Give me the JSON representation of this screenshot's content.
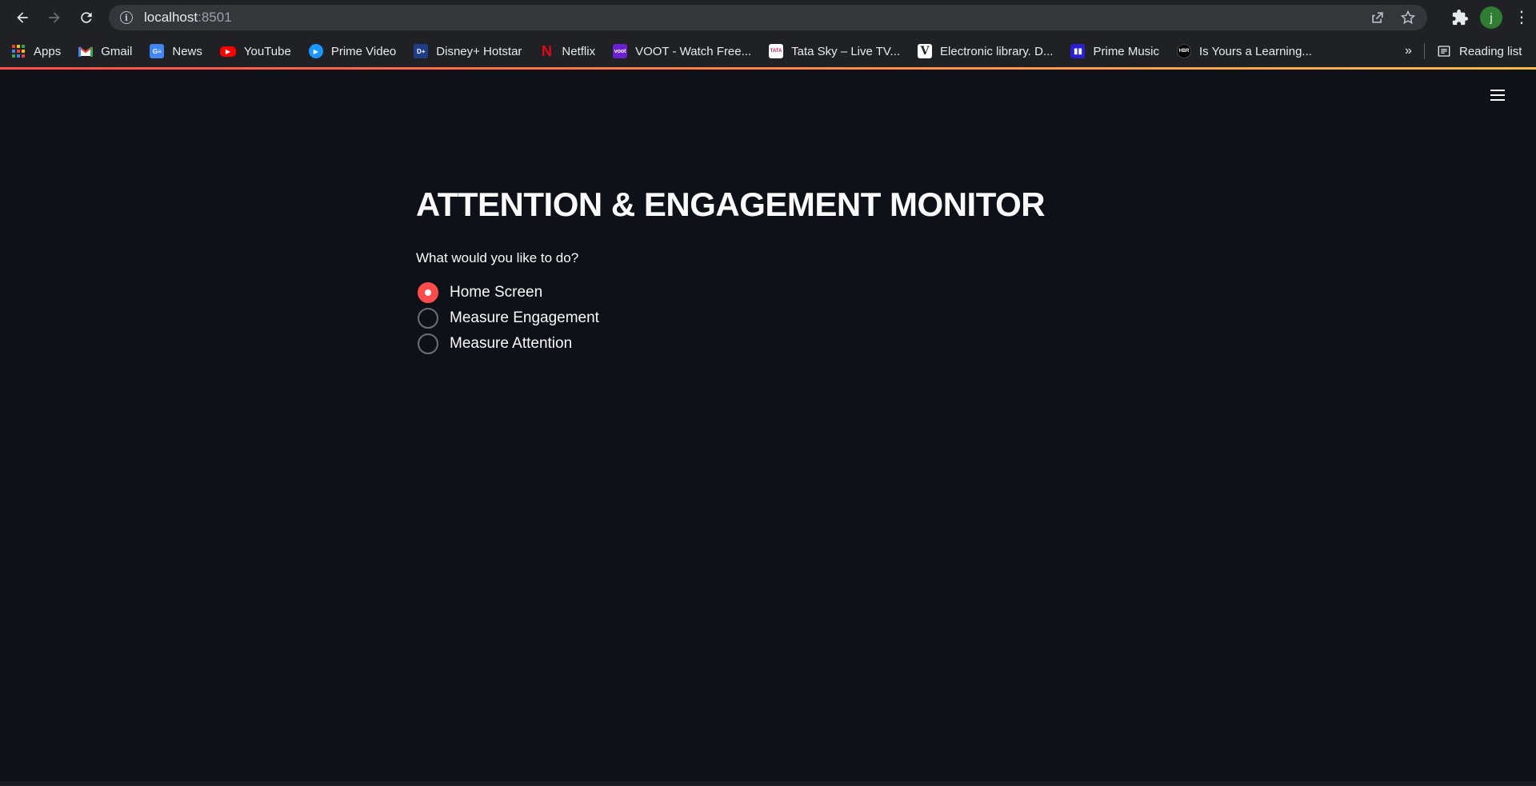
{
  "browser": {
    "url_host": "localhost",
    "url_port": ":8501",
    "profile_initial": "j"
  },
  "bookmarks": [
    {
      "label": "Apps",
      "icon": "apps-grid-icon",
      "color": "#ea4335"
    },
    {
      "label": "Gmail",
      "icon": "gmail-icon",
      "color": "#ea4335"
    },
    {
      "label": "News",
      "icon": "google-news-icon",
      "color": "#4285f4"
    },
    {
      "label": "YouTube",
      "icon": "youtube-icon",
      "color": "#ff0000"
    },
    {
      "label": "Prime Video",
      "icon": "prime-video-icon",
      "color": "#1a98ff"
    },
    {
      "label": "Disney+ Hotstar",
      "icon": "hotstar-icon",
      "color": "#1f3c88"
    },
    {
      "label": "Netflix",
      "icon": "netflix-icon",
      "color": "#e50914"
    },
    {
      "label": "VOOT - Watch Free...",
      "icon": "voot-icon",
      "color": "#6a1fd1"
    },
    {
      "label": "Tata Sky – Live TV...",
      "icon": "tata-sky-icon",
      "color": "#ffffff"
    },
    {
      "label": "Electronic library. D...",
      "icon": "electronic-library-icon",
      "color": "#ffffff"
    },
    {
      "label": "Prime Music",
      "icon": "prime-music-icon",
      "color": "#2a1fd1"
    },
    {
      "label": "Is Yours a Learning...",
      "icon": "hbr-icon",
      "color": "#000000"
    }
  ],
  "reading_list_label": "Reading list",
  "app": {
    "title": "ATTENTION & ENGAGEMENT MONITOR",
    "question": "What would you like to do?",
    "options": [
      {
        "label": "Home Screen",
        "selected": true
      },
      {
        "label": "Measure Engagement",
        "selected": false
      },
      {
        "label": "Measure Attention",
        "selected": false
      }
    ],
    "accent_color": "#ff4b4b",
    "background_color": "#0e1117"
  }
}
